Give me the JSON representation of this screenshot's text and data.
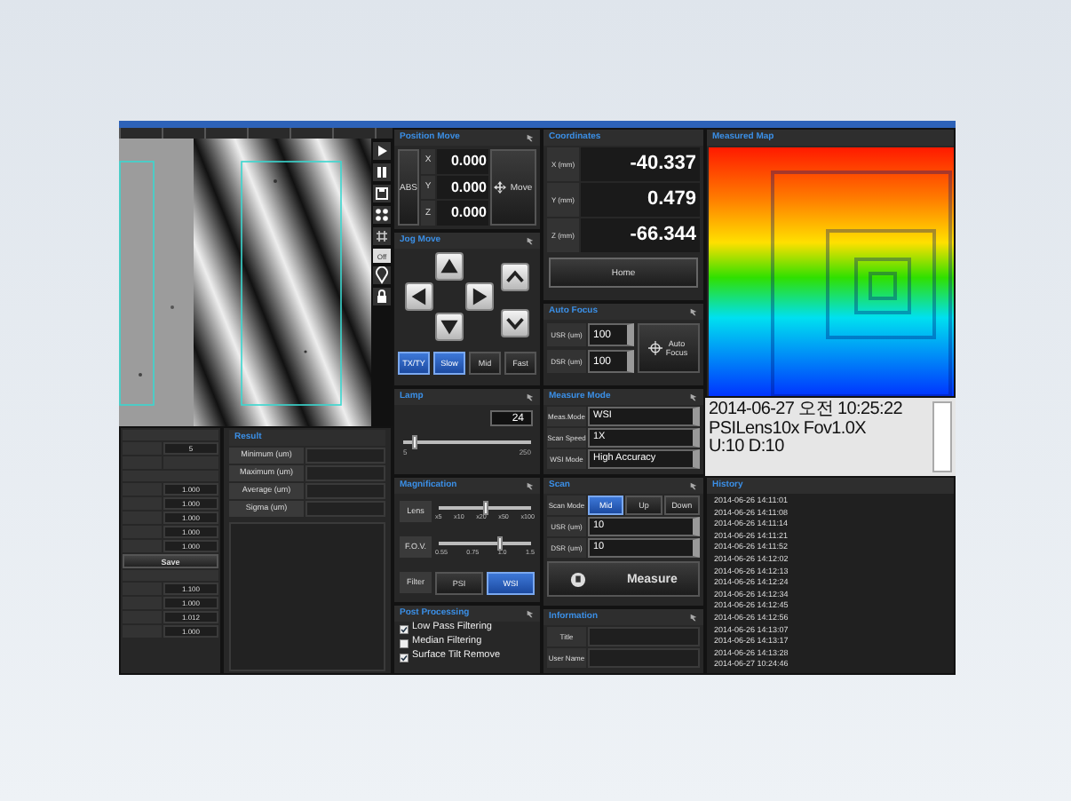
{
  "viewer": {
    "off_label": "Off"
  },
  "settings": {
    "value": "5",
    "group_1": [
      "1.000",
      "1.000",
      "1.000",
      "1.000",
      "1.000"
    ],
    "save": "Save",
    "group_2": [
      "1.100",
      "1.000",
      "1.012",
      "1.000"
    ]
  },
  "result": {
    "title": "Result",
    "rows": [
      "Minimum (um)",
      "Maximum (um)",
      "Average (um)",
      "Sigma (um)"
    ]
  },
  "position_move": {
    "title": "Position Move",
    "abs": "ABS",
    "axes": [
      {
        "label": "X",
        "value": "0.000"
      },
      {
        "label": "Y",
        "value": "0.000"
      },
      {
        "label": "Z",
        "value": "0.000"
      }
    ],
    "move": "Move"
  },
  "jog_move": {
    "title": "Jog Move",
    "speeds": [
      {
        "label": "TX/TY",
        "selected": true
      },
      {
        "label": "Slow",
        "selected": true
      },
      {
        "label": "Mid",
        "selected": false
      },
      {
        "label": "Fast",
        "selected": false
      }
    ]
  },
  "lamp": {
    "title": "Lamp",
    "value": "24",
    "level": 0.09,
    "min": "5",
    "max": "250"
  },
  "magnification": {
    "title": "Magnification",
    "sliders": [
      {
        "label": "Lens",
        "level": 0.5,
        "ticks": [
          "x5",
          "x10",
          "x20",
          "x50",
          "x100"
        ]
      },
      {
        "label": "F.O.V.",
        "level": 0.67,
        "ticks": [
          "0.55",
          "0.75",
          "1.0",
          "1.5"
        ]
      }
    ],
    "filter": {
      "label": "Filter",
      "options": [
        {
          "label": "PSI",
          "selected": false
        },
        {
          "label": "WSI",
          "selected": true
        }
      ]
    }
  },
  "post_processing": {
    "title": "Post Processing",
    "items": [
      {
        "label": "Low Pass Filtering",
        "checked": true
      },
      {
        "label": "Median Filtering",
        "checked": false
      },
      {
        "label": "Surface Tilt Remove",
        "checked": true
      }
    ]
  },
  "coordinates": {
    "title": "Coordinates",
    "rows": [
      {
        "label": "X (mm)",
        "value": "-40.337"
      },
      {
        "label": "Y (mm)",
        "value": "0.479"
      },
      {
        "label": "Z (mm)",
        "value": "-66.344"
      }
    ],
    "home": "Home"
  },
  "auto_focus": {
    "title": "Auto Focus",
    "fields": [
      {
        "label": "USR (um)",
        "value": "100"
      },
      {
        "label": "DSR (um)",
        "value": "100"
      }
    ],
    "button": "Auto Focus"
  },
  "measure_mode": {
    "title": "Measure Mode",
    "fields": [
      {
        "label": "Meas.Mode",
        "value": "WSI"
      },
      {
        "label": "Scan Speed",
        "value": "1X"
      },
      {
        "label": "WSI Mode",
        "value": "High Accuracy"
      }
    ]
  },
  "scan": {
    "title": "Scan",
    "mode_label": "Scan Mode",
    "modes": [
      {
        "label": "Mid",
        "selected": true
      },
      {
        "label": "Up",
        "selected": false
      },
      {
        "label": "Down",
        "selected": false
      }
    ],
    "fields": [
      {
        "label": "USR (um)",
        "value": "10"
      },
      {
        "label": "DSR (um)",
        "value": "10"
      }
    ],
    "measure": "Measure"
  },
  "information": {
    "title": "Information",
    "fields": [
      "Title",
      "User Name"
    ]
  },
  "measured_map": {
    "title": "Measured Map"
  },
  "map_info": [
    "2014-06-27 오전 10:25:22 PSILens10x Fov1.0X",
    "U:10 D:10"
  ],
  "history": {
    "title": "History",
    "entries": [
      "2014-06-26 14:11:01",
      "2014-06-26 14:11:08",
      "2014-06-26 14:11:14",
      "2014-06-26 14:11:21",
      "2014-06-26 14:11:52",
      "2014-06-26 14:12:02",
      "2014-06-26 14:12:13",
      "2014-06-26 14:12:24",
      "2014-06-26 14:12:34",
      "2014-06-26 14:12:45",
      "2014-06-26 14:12:56",
      "2014-06-26 14:13:07",
      "2014-06-26 14:13:17",
      "2014-06-26 14:13:28",
      "2014-06-27 10:24:46"
    ]
  }
}
